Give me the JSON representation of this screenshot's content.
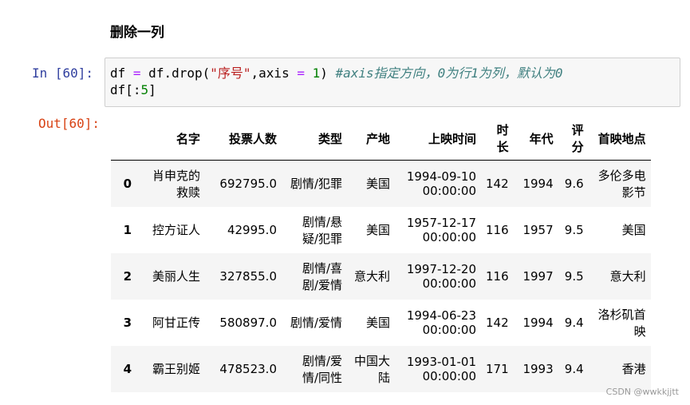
{
  "markdown": {
    "heading": "删除一列"
  },
  "input_cell": {
    "prompt": "In  [60]:",
    "line1": {
      "lhs": "df ",
      "eq": "=",
      "call": " df.drop(",
      "str": "\"序号\"",
      "mid": ",axis ",
      "eq2": "=",
      "num": " 1",
      "close": ") ",
      "comment": "#axis指定方向，0为行1为列，默认为0"
    },
    "line2": {
      "prefix": "df[:",
      "num": "5",
      "suffix": "]"
    }
  },
  "output_cell": {
    "prompt": "Out[60]:",
    "table": {
      "headers": [
        "",
        "名字",
        "投票人数",
        "类型",
        "产地",
        "上映时间",
        "时长",
        "年代",
        "评分",
        "首映地点"
      ],
      "rows": [
        {
          "index": "0",
          "name": "肖申克的救赎",
          "votes": "692795.0",
          "type": "剧情/犯罪",
          "country": "美国",
          "date": "1994-09-10 00:00:00",
          "duration": "142",
          "year": "1994",
          "score": "9.6",
          "place": "多伦多电影节"
        },
        {
          "index": "1",
          "name": "控方证人",
          "votes": "42995.0",
          "type": "剧情/悬疑/犯罪",
          "country": "美国",
          "date": "1957-12-17 00:00:00",
          "duration": "116",
          "year": "1957",
          "score": "9.5",
          "place": "美国"
        },
        {
          "index": "2",
          "name": "美丽人生",
          "votes": "327855.0",
          "type": "剧情/喜剧/爱情",
          "country": "意大利",
          "date": "1997-12-20 00:00:00",
          "duration": "116",
          "year": "1997",
          "score": "9.5",
          "place": "意大利"
        },
        {
          "index": "3",
          "name": "阿甘正传",
          "votes": "580897.0",
          "type": "剧情/爱情",
          "country": "美国",
          "date": "1994-06-23 00:00:00",
          "duration": "142",
          "year": "1994",
          "score": "9.4",
          "place": "洛杉矶首映"
        },
        {
          "index": "4",
          "name": "霸王别姬",
          "votes": "478523.0",
          "type": "剧情/爱情/同性",
          "country": "中国大陆",
          "date": "1993-01-01 00:00:00",
          "duration": "171",
          "year": "1993",
          "score": "9.4",
          "place": "香港"
        }
      ]
    }
  },
  "watermark": "CSDN @wwkkjjtt"
}
